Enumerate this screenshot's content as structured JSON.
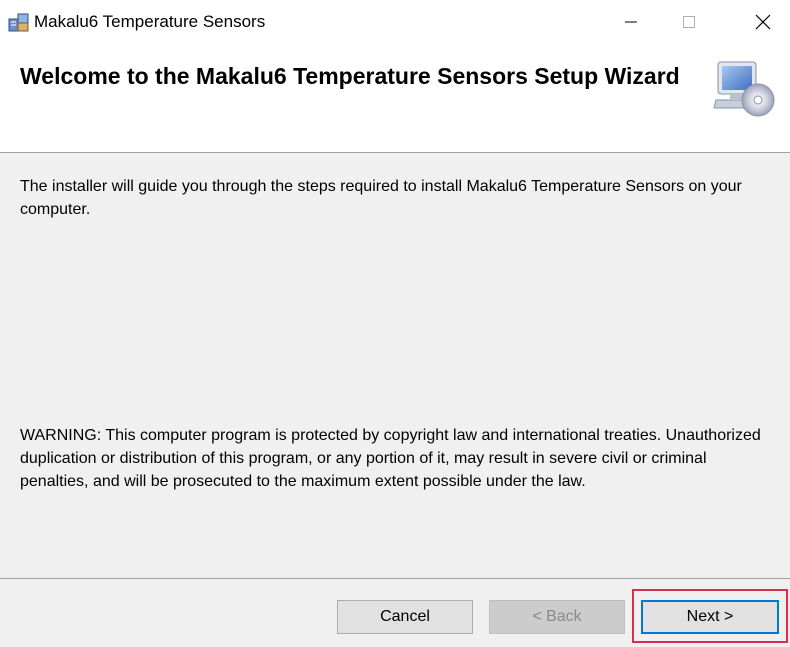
{
  "window": {
    "title": "Makalu6 Temperature Sensors",
    "controls": {
      "minimize_icon": "minimize-icon",
      "maximize_icon": "maximize-icon",
      "close_icon": "close-icon"
    }
  },
  "header": {
    "title": "Welcome to the Makalu6 Temperature Sensors  Setup Wizard",
    "icon": "computer-disc-icon"
  },
  "content": {
    "intro": "The installer will guide you through the steps required to install Makalu6 Temperature Sensors  on your computer.",
    "warning": "WARNING: This computer program is protected by copyright law and international treaties. Unauthorized duplication or distribution of this program, or any portion of it, may result in severe civil or criminal penalties, and will be prosecuted to the maximum extent possible under the law."
  },
  "buttons": {
    "cancel": "Cancel",
    "back": "< Back",
    "next": "Next >"
  },
  "colors": {
    "content_bg": "#f0f0f0",
    "focus_border": "#0078d7",
    "highlight": "#d32f4f"
  }
}
